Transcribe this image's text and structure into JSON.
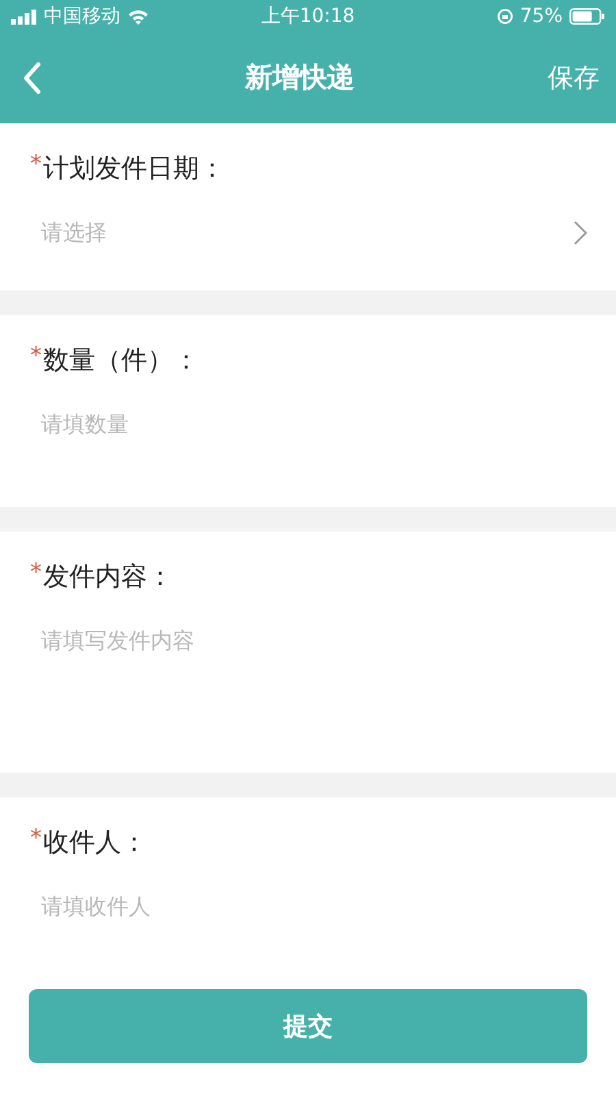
{
  "status_bar": {
    "carrier": "中国移动",
    "time": "上午10:18",
    "battery": "75%"
  },
  "header": {
    "title": "新增快递",
    "action": "保存"
  },
  "fields": [
    {
      "kind": "select",
      "required_mark": "*",
      "label": "计划发件日期：",
      "placeholder": "请选择"
    },
    {
      "kind": "input",
      "required_mark": "*",
      "label": "数量（件）：",
      "placeholder": "请填数量"
    },
    {
      "kind": "textarea",
      "required_mark": "*",
      "label": "发件内容：",
      "placeholder": "请填写发件内容"
    },
    {
      "kind": "input",
      "required_mark": "*",
      "label": "收件人：",
      "placeholder": "请填收件人"
    }
  ],
  "submit": "提交"
}
